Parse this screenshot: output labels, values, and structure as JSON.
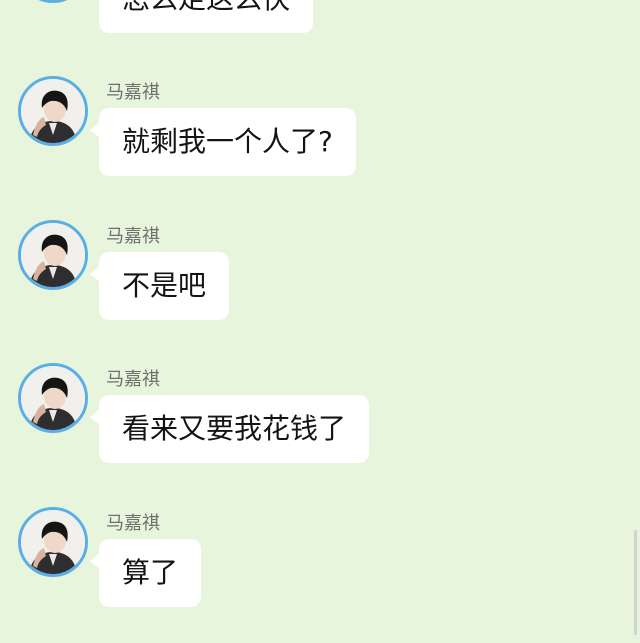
{
  "chat": {
    "messages": [
      {
        "sender": "",
        "text": "怎么走这么快",
        "show_avatar": true
      },
      {
        "sender": "马嘉祺",
        "text": "就剩我一个人了?",
        "show_avatar": true
      },
      {
        "sender": "马嘉祺",
        "text": "不是吧",
        "show_avatar": true
      },
      {
        "sender": "马嘉祺",
        "text": "看来又要我花钱了",
        "show_avatar": true
      },
      {
        "sender": "马嘉祺",
        "text": "算了",
        "show_avatar": true
      }
    ]
  },
  "colors": {
    "background": "#e6f5dc",
    "avatar_ring": "#5aaee6",
    "bubble": "#ffffff",
    "sender_name": "#6f6f6f",
    "message_text": "#141414"
  },
  "icons": {
    "avatar": "user-avatar-photo"
  }
}
